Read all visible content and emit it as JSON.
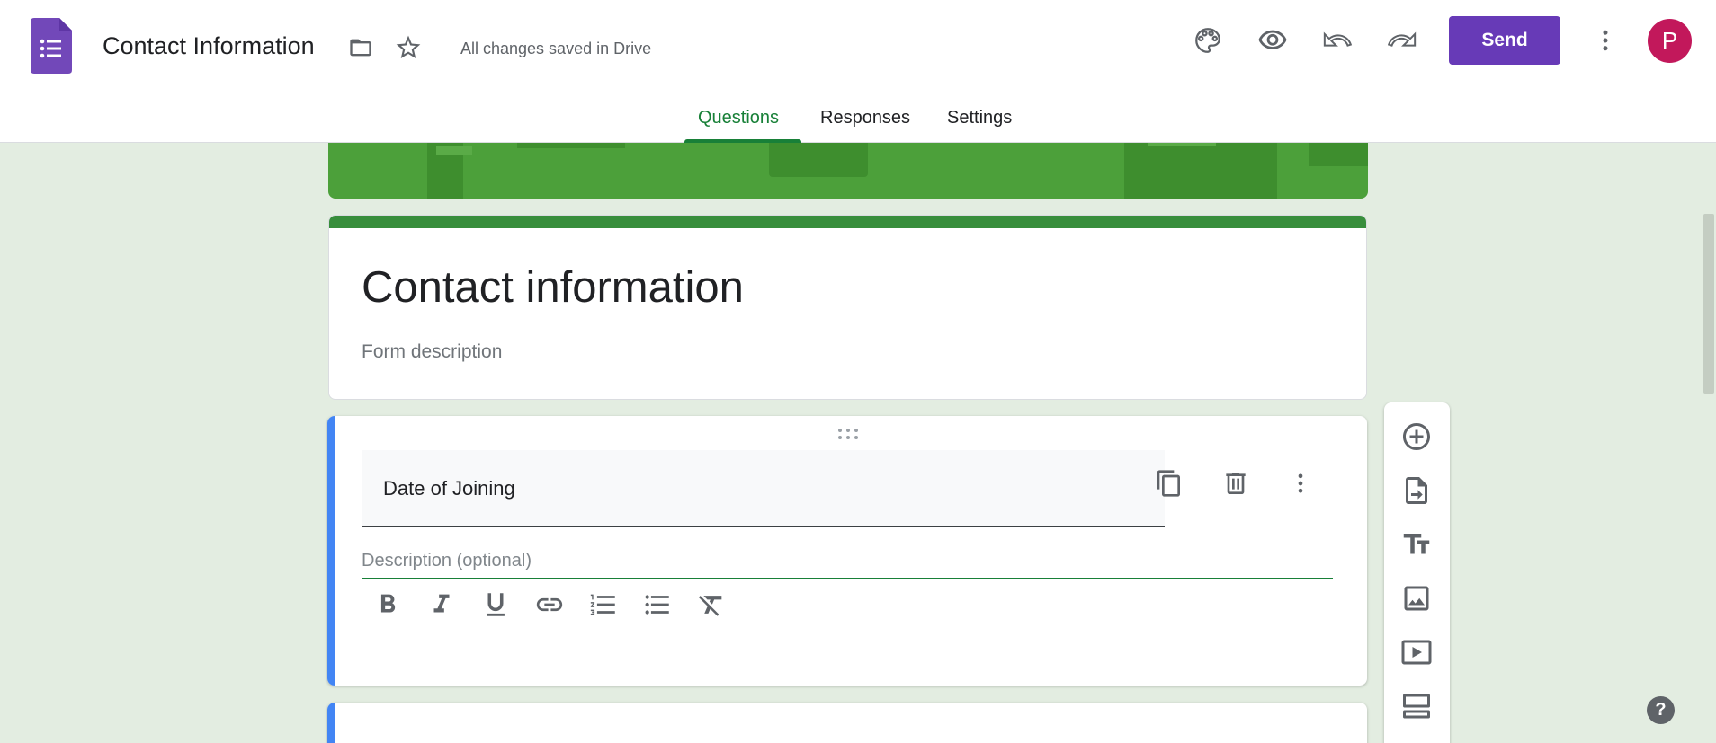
{
  "header": {
    "doc_title": "Contact Information",
    "saved_status": "All changes saved in Drive",
    "send_label": "Send",
    "avatar_letter": "P"
  },
  "tabs": [
    {
      "label": "Questions",
      "active": true
    },
    {
      "label": "Responses",
      "active": false
    },
    {
      "label": "Settings",
      "active": false
    }
  ],
  "form": {
    "title": "Contact information",
    "description_placeholder": "Form description"
  },
  "question": {
    "title": "Date of Joining",
    "description_placeholder": "Description (optional)",
    "format_tools": [
      "bold-icon",
      "italic-icon",
      "underline-icon",
      "link-icon",
      "numbered-list-icon",
      "bulleted-list-icon",
      "clear-format-icon"
    ]
  },
  "side_toolbar": [
    "add-question-icon",
    "import-questions-icon",
    "add-title-icon",
    "add-image-icon",
    "add-video-icon",
    "add-section-icon"
  ],
  "help_label": "?",
  "colors": {
    "accent_purple": "#673ab7",
    "theme_green": "#388e3c",
    "background": "#e3ede1",
    "question_accent": "#4285f4",
    "avatar": "#c2185b"
  }
}
